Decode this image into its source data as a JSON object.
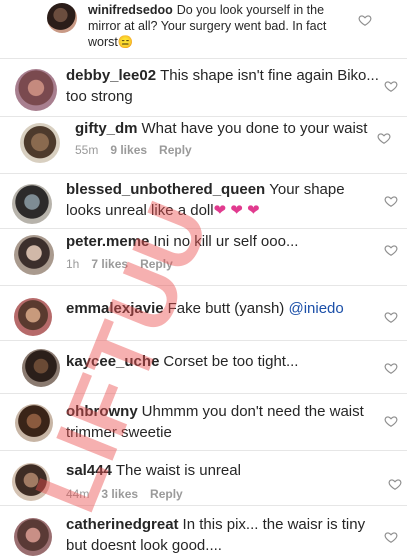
{
  "comments": [
    {
      "user": "winifredsedoo",
      "text": "Do you look yourself in the mirror at all? Your surgery went bad. In fact worst😑",
      "time": "",
      "likes": ""
    },
    {
      "user": "debby_lee02",
      "text": "This shape isn't fine again Biko... too strong",
      "time": "",
      "likes": "",
      "reply": ""
    },
    {
      "user": "gifty_dm",
      "text": "What have you done to your waist",
      "time": "55m",
      "likes": "9 likes",
      "reply": "Reply"
    },
    {
      "user": "blessed_unbothered_queen",
      "text": "Your shape looks unreal like a doll",
      "emoji": "❤ ❤ ❤",
      "time": "",
      "likes": "",
      "reply": ""
    },
    {
      "user": "peter.meme",
      "text": "Ini no kill ur self ooo...",
      "time": "1h",
      "likes": "7 likes",
      "reply": "Reply"
    },
    {
      "user": "emmalexjavie",
      "text": "Fake butt (yansh)",
      "mention": "@iniedo",
      "time": "",
      "likes": "",
      "reply": ""
    },
    {
      "user": "kaycee_uche",
      "text": "Corset be too tight...",
      "time": "",
      "likes": "",
      "reply": ""
    },
    {
      "user": "ohbrowny",
      "text": "Uhmmm you don't need the waist trimmer sweetie",
      "time": "",
      "likes": "",
      "reply": ""
    },
    {
      "user": "sal444",
      "text": "The waist is unreal",
      "time": "44m",
      "likes": "3 likes",
      "reply": "Reply"
    },
    {
      "user": "catherinedgreat",
      "text": "In this pix... the waisr is tiny but doesnt look good....",
      "time": "",
      "likes": "",
      "reply": ""
    }
  ],
  "watermark": "LIFTUU",
  "colors": {
    "heart_emoji": "#e13b8f",
    "mention": "#1b4fa8",
    "meta": "#9a9a9a"
  }
}
